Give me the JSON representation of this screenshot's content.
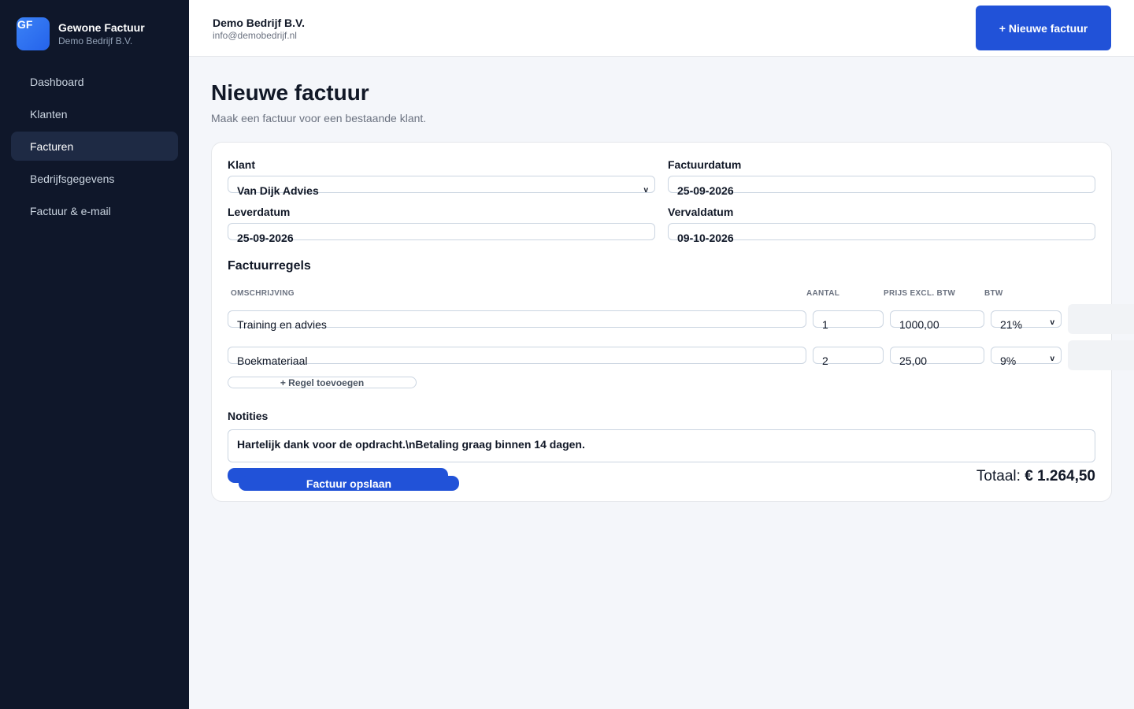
{
  "brand": {
    "logo_text": "GF",
    "title": "Gewone Factuur",
    "subtitle": "Demo Bedrijf B.V."
  },
  "sidebar": {
    "items": [
      {
        "label": "Dashboard",
        "active": false
      },
      {
        "label": "Klanten",
        "active": false
      },
      {
        "label": "Facturen",
        "active": true
      },
      {
        "label": "Bedrijfsgegevens",
        "active": false
      },
      {
        "label": "Factuur & e-mail",
        "active": false
      }
    ]
  },
  "topbar": {
    "company_name": "Demo Bedrijf B.V.",
    "company_email": "info@demobedrijf.nl",
    "new_invoice_label": "+ Nieuwe factuur"
  },
  "page": {
    "title": "Nieuwe factuur",
    "subtitle": "Maak een factuur voor een bestaande klant."
  },
  "form": {
    "klant_label": "Klant",
    "klant_value": "Van Dijk Advies",
    "factuurdatum_label": "Factuurdatum",
    "factuurdatum_value": "25-09-2026",
    "leverdatum_label": "Leverdatum",
    "leverdatum_value": "25-09-2026",
    "vervaldatum_label": "Vervaldatum",
    "vervaldatum_value": "09-10-2026"
  },
  "lines": {
    "title": "Factuurregels",
    "headers": {
      "description": "OMSCHRIJVING",
      "quantity": "AANTAL",
      "price": "PRIJS EXCL. BTW",
      "vat": "BTW"
    },
    "rows": [
      {
        "description": "Training en advies",
        "quantity": "1",
        "price": "1000,00",
        "vat": "21%"
      },
      {
        "description": "Boekmateriaal",
        "quantity": "2",
        "price": "25,00",
        "vat": "9%"
      }
    ],
    "add_label": "+ Regel toevoegen"
  },
  "notes": {
    "label": "Notities",
    "value": "Hartelijk dank voor de opdracht.\\nBetaling graag binnen 14 dagen."
  },
  "footer": {
    "save_label": "Factuur opslaan",
    "total_label": "Totaal:",
    "total_value": "€ 1.264,50"
  },
  "colors": {
    "sidebar_bg": "#0f172a",
    "sidebar_active": "#1e2a44",
    "primary": "#2152d8",
    "page_bg": "#f4f6fa"
  }
}
